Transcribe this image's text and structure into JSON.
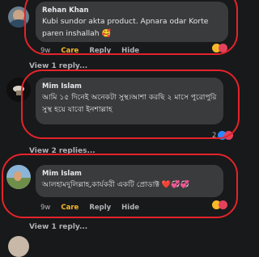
{
  "comments": [
    {
      "author": "Rehan Khan",
      "text": "Kubi sundor akta product. Apnara odar Korte paren inshallah 🥰",
      "time": "9w",
      "reaction_label": "Care",
      "reply_label": "Reply",
      "hide_label": "Hide",
      "view_replies": "View 1 reply..."
    },
    {
      "author": "Mim Islam",
      "text": "আমি ১৫ দিনেই অনেকটা সুস্থ।আশা করছি ২ মাসে পুরোপুরি সুস্থ হয়ে যাবো ইনশাল্লাহ",
      "reaction_count": "2",
      "view_replies": "View 2 replies..."
    },
    {
      "author": "Mim Islam",
      "text": "আলহামদুলিল্লাহ,কার্যকরী একটি প্রোডাক্ট ❤️💞💞",
      "time": "9w",
      "reaction_label": "Care",
      "reply_label": "Reply",
      "hide_label": "Hide",
      "view_replies": "View 1 reply..."
    }
  ],
  "colors": {
    "background": "#18191a",
    "bubble": "#3a3b3c",
    "annotation_outline": "#e5232b",
    "care_reaction": "#f7b928"
  }
}
